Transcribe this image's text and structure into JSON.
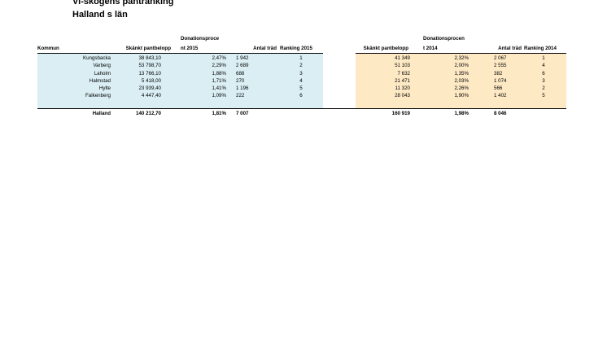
{
  "title_line1": "Vi-skogens pantranking",
  "title_line2": "Halland  s län",
  "headers": {
    "kommun": "Kommun",
    "skankt_2015": "Skänkt pantbelopp",
    "donation_2015_a": "Donationsproce",
    "donation_2015_b": "nt 2015",
    "trad_2015": "Antal träd",
    "ranking_2015": "Ranking 2015",
    "skankt_2014": "Skänkt pantbelopp",
    "donation_2014_a": "Donationsprocen",
    "donation_2014_b": "t 2014",
    "trad_2014": "Antal träd",
    "ranking_2014": "Ranking 2014"
  },
  "colors": {
    "band_2015": "#daeef3",
    "band_2014": "#fde9c4",
    "ranking_2014_highlight": "#fcd5a0"
  },
  "rows": [
    {
      "kommun": "Kungsbacka",
      "skankt_2015": "38 843,10",
      "donation_2015": "2,47%",
      "trad_2015": "1 942",
      "ranking_2015": "1",
      "skankt_2014": "41 349",
      "donation_2014": "2,32%",
      "trad_2014": "2 067",
      "ranking_2014": "1"
    },
    {
      "kommun": "Varberg",
      "skankt_2015": "53 798,70",
      "donation_2015": "2,29%",
      "trad_2015": "2 689",
      "ranking_2015": "2",
      "skankt_2014": "51 103",
      "donation_2014": "2,00%",
      "trad_2014": "2 555",
      "ranking_2014": "4"
    },
    {
      "kommun": "Laholm",
      "skankt_2015": "13 766,10",
      "donation_2015": "1,88%",
      "trad_2015": "688",
      "ranking_2015": "3",
      "skankt_2014": "7 632",
      "donation_2014": "1,35%",
      "trad_2014": "382",
      "ranking_2014": "6"
    },
    {
      "kommun": "Halmstad",
      "skankt_2015": "5 418,00",
      "donation_2015": "1,71%",
      "trad_2015": "270",
      "ranking_2015": "4",
      "skankt_2014": "21 471",
      "donation_2014": "2,03%",
      "trad_2014": "1 074",
      "ranking_2014": "3"
    },
    {
      "kommun": "Hylte",
      "skankt_2015": "23 939,40",
      "donation_2015": "1,41%",
      "trad_2015": "1 196",
      "ranking_2015": "5",
      "skankt_2014": "11 320",
      "donation_2014": "2,26%",
      "trad_2014": "566",
      "ranking_2014": "2"
    },
    {
      "kommun": "Falkenberg",
      "skankt_2015": "4 447,40",
      "donation_2015": "1,09%",
      "trad_2015": "222",
      "ranking_2015": "6",
      "skankt_2014": "28 043",
      "donation_2014": "1,90%",
      "trad_2014": "1 402",
      "ranking_2014": "5"
    }
  ],
  "total": {
    "kommun": "Halland",
    "skankt_2015": "140 212,70",
    "donation_2015": "1,81%",
    "trad_2015": "7 007",
    "skankt_2014": "160 919",
    "donation_2014": "1,98%",
    "trad_2014": "8 046"
  }
}
